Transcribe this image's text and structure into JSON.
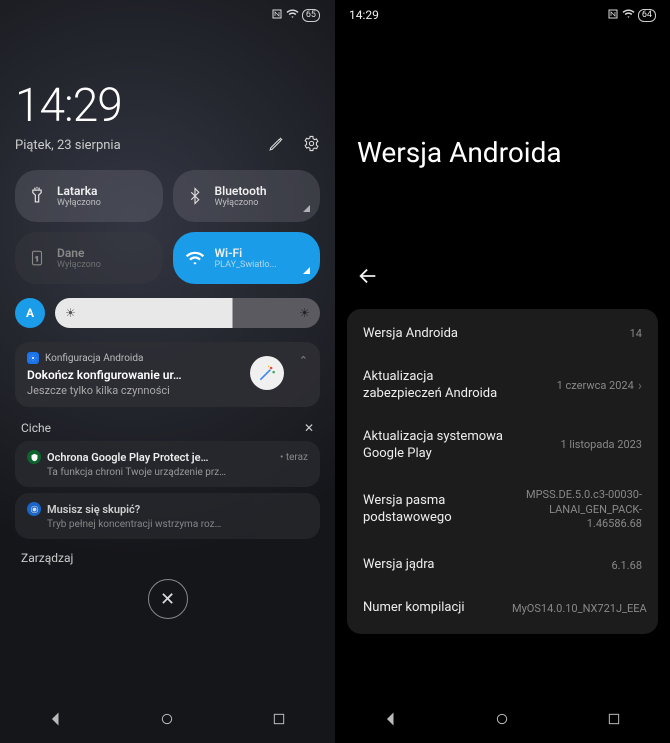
{
  "left": {
    "status": {
      "battery": "65"
    },
    "clock": "14:29",
    "date": "Piątek, 23 sierpnia",
    "qs": {
      "flashlight": {
        "title": "Latarka",
        "sub": "Wyłączono"
      },
      "bluetooth": {
        "title": "Bluetooth",
        "sub": "Wyłączono"
      },
      "data": {
        "title": "Dane",
        "sub": "Wyłączono"
      },
      "wifi": {
        "title": "Wi-Fi",
        "sub": "PLAY_Swiatlo..."
      }
    },
    "auto_brightness_label": "A",
    "notif_config": {
      "app": "Konfiguracja Androida",
      "title": "Dokończ konfigurowanie ur…",
      "body": "Jeszcze tylko kilka czynności"
    },
    "silent_header": "Ciche",
    "notif_protect": {
      "title": "Ochrona Google Play Protect je…",
      "time": "teraz",
      "body": "Ta funkcja chroni Twoje urządzenie prz…"
    },
    "notif_focus": {
      "title": "Musisz się skupić?",
      "body": "Tryb pełnej koncentracji wstrzyma roz…"
    },
    "manage": "Zarządzaj"
  },
  "right": {
    "clock": "14:29",
    "battery": "64",
    "title": "Wersja Androida",
    "rows": {
      "android_version": {
        "label": "Wersja Androida",
        "value": "14"
      },
      "security_update": {
        "label": "Aktualizacja zabezpieczeń Androida",
        "value": "1 czerwca 2024"
      },
      "play_update": {
        "label": "Aktualizacja systemowa Google Play",
        "value": "1 listopada 2023"
      },
      "baseband": {
        "label": "Wersja pasma podstawowego",
        "value": "MPSS.DE.5.0.c3-00030-LANAI_GEN_PACK-1.46586.68"
      },
      "kernel": {
        "label": "Wersja jądra",
        "value": "6.1.68"
      },
      "build": {
        "label": "Numer kompilacji",
        "value": "MyOS14.0.10_NX721J_EEA"
      }
    }
  }
}
